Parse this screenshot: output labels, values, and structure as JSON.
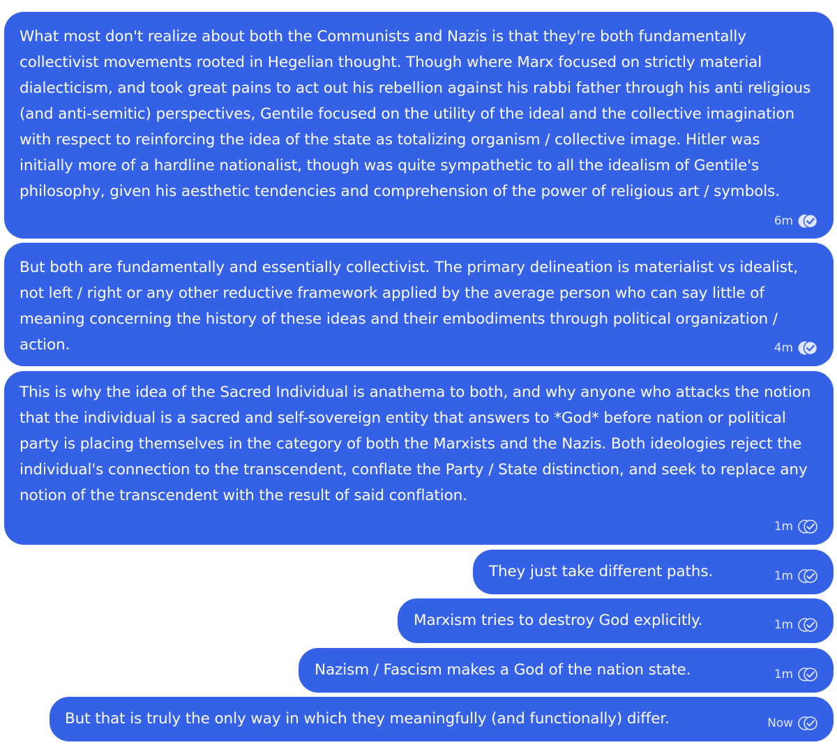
{
  "messages": [
    {
      "text": "What most don't realize about both the Communists and Nazis is that they're both fundamentally collectivist movements rooted in Hegelian thought. Though where Marx focused on strictly material dialecticism, and took great pains to act out his rebellion against his rabbi father through his anti religious (and anti-semitic) perspectives, Gentile focused on the utility of the ideal and the collective imagination with respect to reinforcing the idea of the state as totalizing organism / collective image. Hitler was initially more of a hardline nationalist, though was quite sympathetic to all the idealism of Gentile's philosophy, given his aesthetic tendencies and comprehension of the power of religious art / symbols.",
      "time": "6m",
      "status_icon": "read-double-check-icon"
    },
    {
      "text": "But both are fundamentally and essentially collectivist. The primary delineation is materialist vs idealist, not left / right or any other reductive framework applied by the average person who can say little of meaning concerning the history of these ideas and their embodiments through political organization / action.",
      "time": "4m",
      "status_icon": "read-double-check-icon"
    },
    {
      "text": "This is why the idea of the Sacred Individual is anathema to both, and why anyone who attacks the notion that the individual is a sacred and self-sovereign entity that answers to *God* before nation or political party is placing themselves in the category of both the Marxists and the Nazis. Both ideologies reject the individual's connection to the transcendent, conflate the Party / State distinction, and seek to replace any notion of the transcendent with the result of said conflation.",
      "time": "1m",
      "status_icon": "delivered-double-check-icon"
    },
    {
      "text": "They just take different paths.",
      "time": "1m",
      "status_icon": "delivered-double-check-icon"
    },
    {
      "text": "Marxism tries to destroy God explicitly.",
      "time": "1m",
      "status_icon": "delivered-double-check-icon"
    },
    {
      "text": "Nazism / Fascism makes a God of the nation state.",
      "time": "1m",
      "status_icon": "delivered-double-check-icon"
    },
    {
      "text": "But that is truly the only way in which they meaningfully (and functionally) differ.",
      "time": "Now",
      "status_icon": "delivered-double-check-icon"
    }
  ],
  "colors": {
    "bubble": "#3561e6",
    "text": "#ffffff",
    "meta": "#dfe6ff",
    "background": "#ffffff"
  }
}
